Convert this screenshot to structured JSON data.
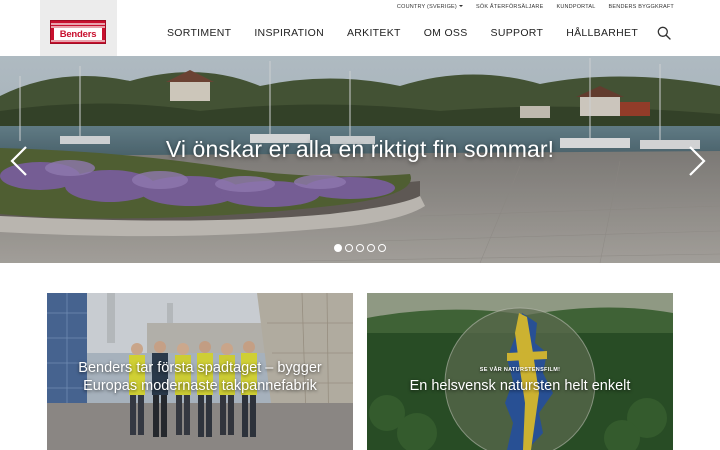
{
  "brand": {
    "logo_text": "Benders",
    "color": "#c8102e"
  },
  "utility_nav": {
    "country": "COUNTRY (SVERIGE)",
    "items": [
      "SÖK ÅTERFÖRSÄLJARE",
      "KUNDPORTAL",
      "BENDERS BYGGKRAFT"
    ]
  },
  "main_nav": [
    "SORTIMENT",
    "INSPIRATION",
    "ARKITEKT",
    "OM OSS",
    "SUPPORT",
    "HÅLLBARHET"
  ],
  "hero": {
    "title": "Vi önskar er alla en riktigt fin sommar!",
    "slide_count": 5,
    "active_slide": 1
  },
  "cards": [
    {
      "title": "Benders tar första spadtaget – bygger Europas modernaste takpannefabrik"
    },
    {
      "kicker": "SE VÅR NATURSTENSFILM!",
      "title": "En helsvensk natursten helt enkelt"
    }
  ],
  "icons": {
    "search": "search-icon",
    "prev": "chevron-left-icon",
    "next": "chevron-right-icon",
    "caret": "caret-down-icon"
  }
}
